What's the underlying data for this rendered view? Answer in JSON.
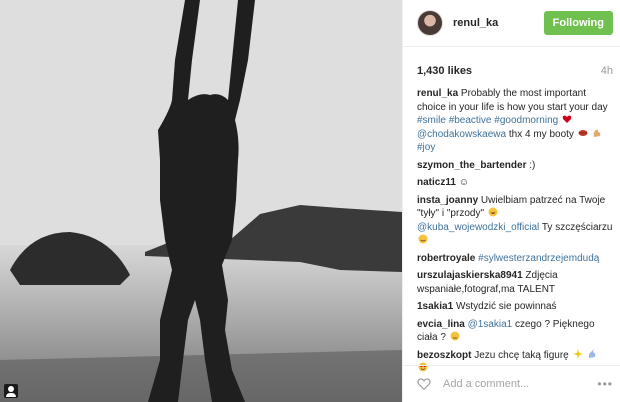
{
  "post": {
    "username": "renul_ka",
    "follow_label": "Following",
    "likes": "1,430 likes",
    "time": "4h",
    "caption": {
      "user": "renul_ka",
      "text1": "Probably the most important choice in your life is how you start your day",
      "tag1": "#smile",
      "tag2": "#beactive",
      "tag3": "#goodmorning",
      "mention": "@chodakowskaewa",
      "text2": "thx 4 my booty",
      "tag4": "#joy"
    },
    "comments": [
      {
        "user": "szymon_the_bartender",
        "text": ":)"
      },
      {
        "user": "naticz11",
        "text": "☺"
      },
      {
        "user": "insta_joanny",
        "text": "Uwielbiam patrzeć na Twoje \"tyły\" i \"przody\"",
        "mention": "@kuba_wojewodzki_official",
        "text2": "Ty szczęściarzu"
      },
      {
        "user": "robertroyale",
        "tag": "#sylwesterzandrzejemdudą"
      },
      {
        "user": "urszulajaskierska8941",
        "text": "Zdjęcia wspaniałe,fotograf,ma TALENT"
      },
      {
        "user": "1sakia1",
        "text": "Wstydzić sie powinnaś"
      },
      {
        "user": "evcia_lina",
        "mention": "@1sakia1",
        "text": "czego ? Pięknego ciała ?"
      },
      {
        "user": "bezoszkopt",
        "text": "Jezu chcę taką figurę"
      }
    ],
    "add_comment_placeholder": "Add a comment...",
    "more_label": "•••"
  },
  "colors": {
    "follow_green": "#70c050",
    "link_blue": "#3f729b",
    "heart_red": "#d0021b"
  },
  "icons": [
    "user-tag-icon",
    "heart-icon",
    "more-options-icon"
  ]
}
